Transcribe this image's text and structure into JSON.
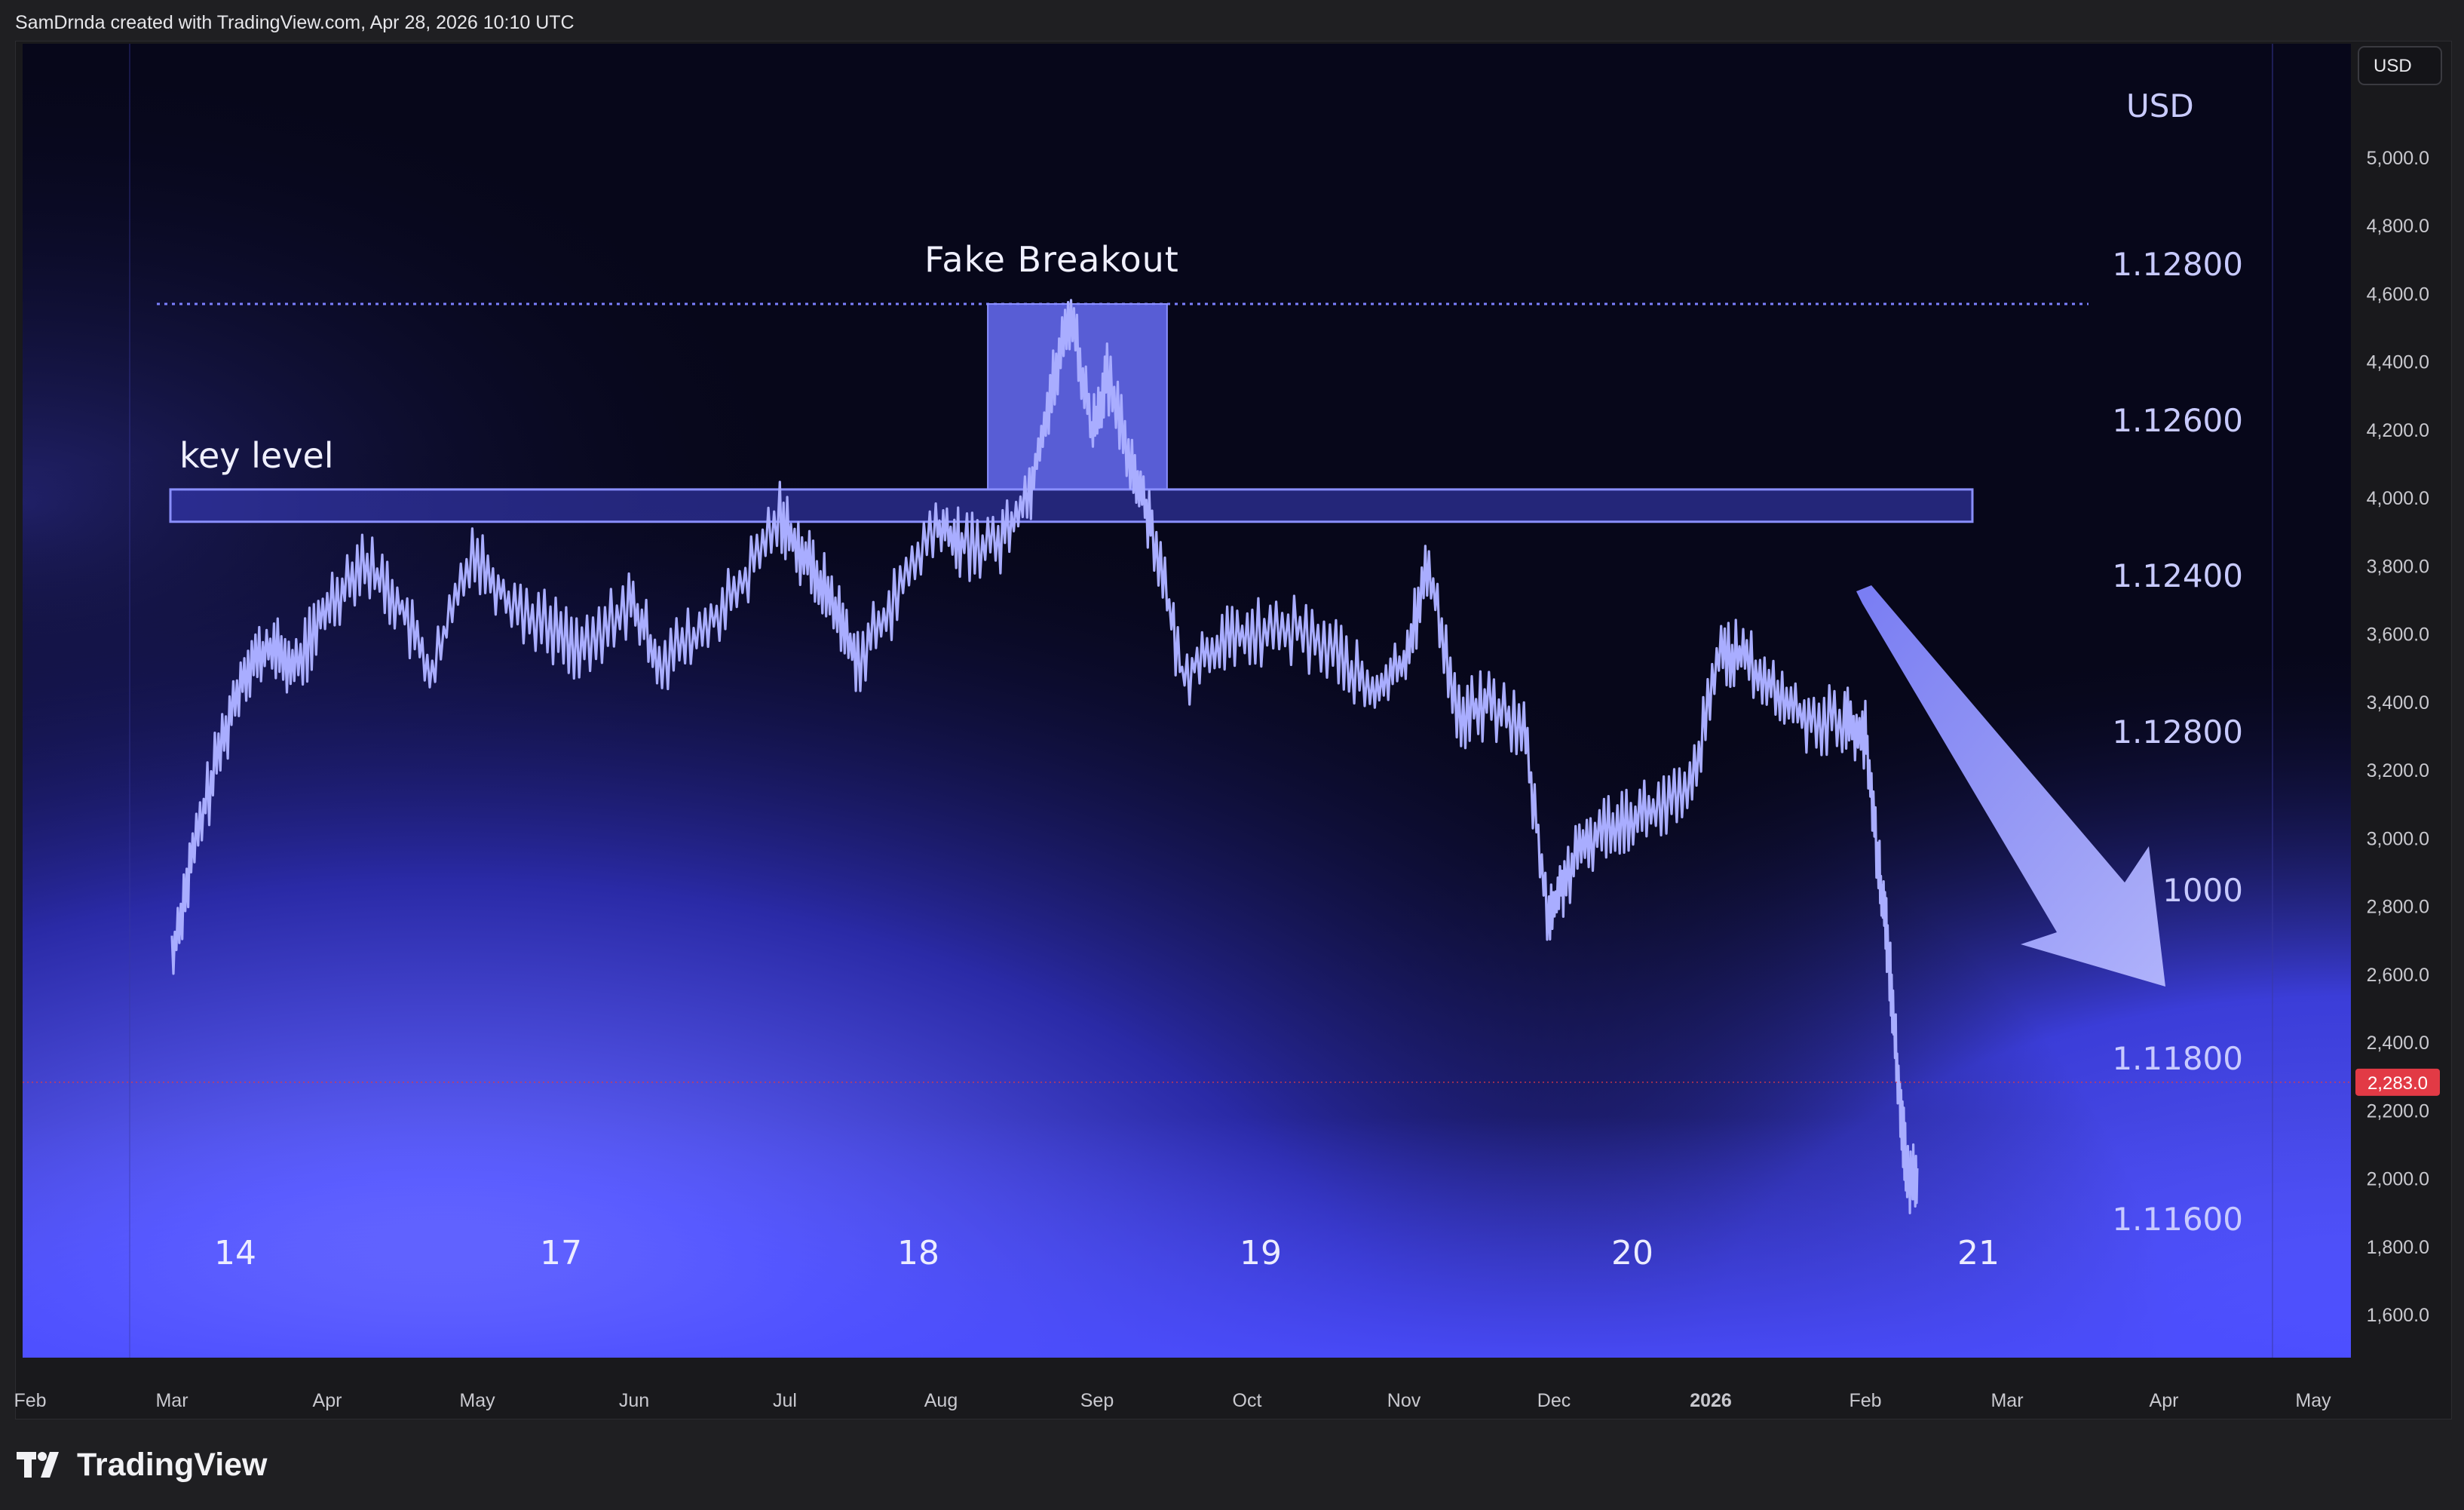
{
  "credit": "SamDrnda created with TradingView.com, Apr 28, 2026 10:10 UTC",
  "brand": "TradingView",
  "currency_badge": "USD",
  "last_price_badge": "2,283.0",
  "colors": {
    "page_bg": "#1f1f22",
    "plot_bg_dark": "#07071a",
    "plot_glow": "#5a5cff",
    "line": "#a9adff",
    "zone_fill": "#6a70ff",
    "zone_stroke": "#8a8fff",
    "arrow": "#9fa3ff",
    "last_price": "#e23a45"
  },
  "chart_data": {
    "type": "line",
    "price_axis": {
      "ticks": [
        "5,000.0",
        "4,800.0",
        "4,600.0",
        "4,400.0",
        "4,200.0",
        "4,000.0",
        "3,800.0",
        "3,600.0",
        "3,400.0",
        "3,200.0",
        "3,000.0",
        "2,800.0",
        "2,600.0",
        "2,400.0",
        "2,200.0",
        "2,000.0",
        "1,800.0",
        "1,600.0"
      ],
      "ylim": [
        1450,
        5250
      ]
    },
    "time_axis": {
      "ticks": [
        "Feb",
        "Mar",
        "Apr",
        "May",
        "Jun",
        "Jul",
        "Aug",
        "Sep",
        "Oct",
        "Nov",
        "Dec",
        "2026",
        "Feb",
        "Mar",
        "Apr",
        "May"
      ],
      "bold": [
        "2026"
      ]
    },
    "last_price": 2283.0,
    "series": [
      {
        "x": [
          "Mar 01",
          "Mar 05",
          "Mar 10",
          "Mar 15",
          "Mar 20",
          "Mar 25",
          "Apr 01",
          "Apr 08",
          "Apr 15",
          "Apr 22",
          "Apr 30",
          "May 07",
          "May 15",
          "May 22",
          "May 30",
          "Jun 06",
          "Jun 14",
          "Jun 22",
          "Jun 30",
          "Jul 05",
          "Jul 10",
          "Jul 15",
          "Jul 22",
          "Jul 30",
          "Aug 05",
          "Aug 12",
          "Aug 18",
          "Aug 22",
          "Aug 26",
          "Aug 30",
          "Sep 03",
          "Sep 08",
          "Sep 12",
          "Sep 18",
          "Sep 25",
          "Oct 02",
          "Oct 10",
          "Oct 18",
          "Oct 25",
          "Nov 01",
          "Nov 06",
          "Nov 12",
          "Nov 18",
          "Nov 25",
          "Nov 30",
          "Dec 03",
          "Dec 08",
          "Dec 14",
          "Dec 20",
          "Dec 27",
          "Jan 03",
          "Jan 08",
          "Jan 14",
          "Jan 20",
          "Jan 27",
          "Feb 01",
          "Feb 04",
          "Feb 06",
          "Feb 08",
          "Feb 10",
          "Feb 12"
        ],
        "y": [
          2650,
          2950,
          3250,
          3500,
          3560,
          3500,
          3680,
          3820,
          3700,
          3480,
          3850,
          3700,
          3620,
          3550,
          3700,
          3520,
          3600,
          3730,
          3950,
          3820,
          3700,
          3520,
          3700,
          3920,
          3860,
          3870,
          4020,
          4300,
          4550,
          4200,
          4350,
          4100,
          3920,
          3480,
          3570,
          3600,
          3610,
          3550,
          3420,
          3520,
          3800,
          3350,
          3400,
          3320,
          2760,
          2880,
          3000,
          3060,
          3080,
          3130,
          3560,
          3520,
          3420,
          3350,
          3350,
          3300,
          2900,
          2650,
          2280,
          1990,
          2030
        ]
      }
    ],
    "annotations": [
      {
        "type": "text",
        "text": "Fake Breakout"
      },
      {
        "type": "text",
        "text": "key level"
      },
      {
        "type": "text",
        "text": "USD"
      },
      {
        "type": "rect",
        "label": "key level zone",
        "y_range": [
          3930,
          4025
        ],
        "x_range": [
          "Feb 28",
          "Feb 10"
        ]
      },
      {
        "type": "rect",
        "label": "fake breakout box",
        "y_range": [
          4025,
          4570
        ],
        "x_range": [
          "Aug 10",
          "Sep 15"
        ]
      },
      {
        "type": "hline",
        "style": "dotted",
        "y": 4570
      },
      {
        "type": "arrow",
        "direction": "down-right"
      }
    ],
    "overlay_labels": {
      "right": [
        "1.12800",
        "1.12600",
        "1.12400",
        "1.12800",
        "1000",
        "1.11800",
        "1.11600"
      ],
      "bottom": [
        "14",
        "17",
        "18",
        "19",
        "20",
        "21"
      ]
    }
  }
}
